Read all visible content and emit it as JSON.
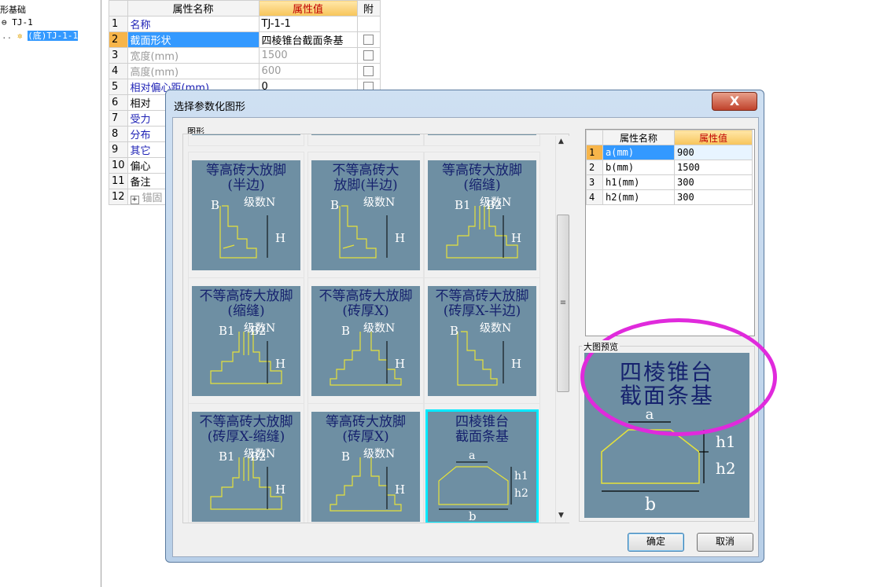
{
  "tree": {
    "root_label": "形基础",
    "child_label": "TJ-1",
    "selected_label": "(底)TJ-1-1"
  },
  "props": {
    "headers": {
      "name": "属性名称",
      "value": "属性值",
      "attach": "附"
    },
    "rows": [
      {
        "num": "1",
        "name": "名称",
        "value": "TJ-1-1"
      },
      {
        "num": "2",
        "name": "截面形状",
        "value": "四棱锥台截面条基"
      },
      {
        "num": "3",
        "name": "宽度(mm)",
        "value": "1500"
      },
      {
        "num": "4",
        "name": "高度(mm)",
        "value": "600"
      },
      {
        "num": "5",
        "name": "相对偏心距(mm)",
        "value": "0"
      },
      {
        "num": "6",
        "name": "相对"
      },
      {
        "num": "7",
        "name": "受力"
      },
      {
        "num": "8",
        "name": "分布"
      },
      {
        "num": "9",
        "name": "其它"
      },
      {
        "num": "10",
        "name": "偏心"
      },
      {
        "num": "11",
        "name": "备注"
      },
      {
        "num": "12",
        "name": "锚固"
      }
    ],
    "expand_glyph": "+"
  },
  "dialog": {
    "title": "选择参数化图形",
    "close_glyph": "X",
    "graph_group_label": "图形",
    "tiles": [
      {
        "caption": "等高砖大放脚\n(半边)"
      },
      {
        "caption": "不等高砖大\n放脚(半边)"
      },
      {
        "caption": "等高砖大放脚\n(缩缝)"
      },
      {
        "caption": "不等高砖大放脚\n(缩缝)"
      },
      {
        "caption": "不等高砖大放脚\n(砖厚X)"
      },
      {
        "caption": "不等高砖大放脚\n(砖厚X-半边)"
      },
      {
        "caption": "不等高砖大放脚\n(砖厚X-缩缝)"
      },
      {
        "caption": "等高砖大放脚\n(砖厚X)"
      },
      {
        "caption": "四棱锥台\n截面条基"
      }
    ],
    "diagram_labels": {
      "b": "B",
      "b1": "B1",
      "b2": "B2",
      "levels": "级数N",
      "h": "H",
      "a": "a",
      "b_small": "b",
      "h1": "h1",
      "h2": "h2"
    },
    "scroll": {
      "up": "▲",
      "down": "▼",
      "grip": "≡"
    },
    "attr_headers": {
      "name": "属性名称",
      "value": "属性值"
    },
    "attr_rows": [
      {
        "num": "1",
        "name": "a(mm)",
        "value": "900"
      },
      {
        "num": "2",
        "name": "b(mm)",
        "value": "1500"
      },
      {
        "num": "3",
        "name": "h1(mm)",
        "value": "300"
      },
      {
        "num": "4",
        "name": "h2(mm)",
        "value": "300"
      }
    ],
    "preview_label": "大图预览",
    "preview_caption": "四棱锥台\n截面条基",
    "ok_label": "确定",
    "cancel_label": "取消"
  },
  "colors": {
    "tile_bg": "#6e8fa3",
    "line": "#e6e23a",
    "caption": "#16226e",
    "highlight": "#e02adc"
  }
}
